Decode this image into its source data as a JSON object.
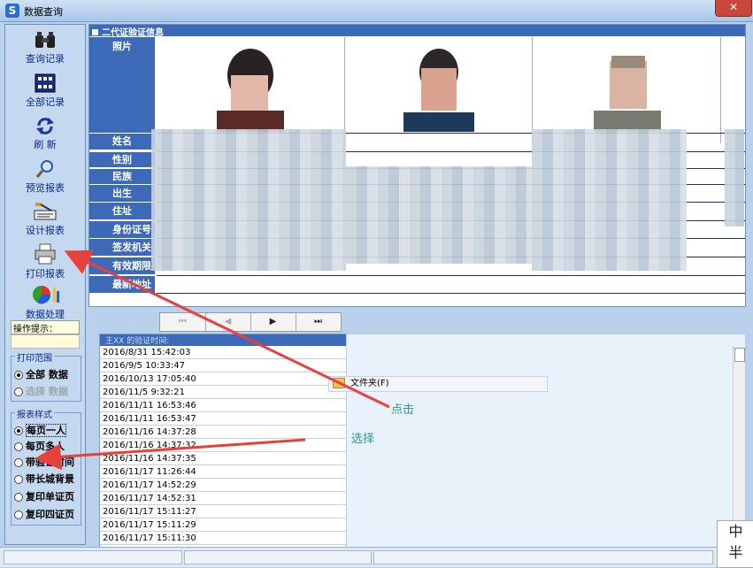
{
  "window": {
    "title": "数据查询",
    "app_icon": "S",
    "close": "✕"
  },
  "sidebar": {
    "tools": [
      {
        "label": "查询记录",
        "icon": "binoculars-icon"
      },
      {
        "label": "全部记录",
        "icon": "grid-icon"
      },
      {
        "label": "刷 新",
        "icon": "refresh-icon"
      },
      {
        "label": "预览报表",
        "icon": "magnifier-icon"
      },
      {
        "label": "设计报表",
        "icon": "design-icon"
      },
      {
        "label": "打印报表",
        "icon": "printer-icon"
      },
      {
        "label": "数据处理",
        "icon": "pie-chart-icon"
      }
    ],
    "hint_label": "操作提示：",
    "print_range": {
      "title": "打印范围",
      "options": [
        {
          "label": "全部 数据",
          "checked": true,
          "enabled": true
        },
        {
          "label": "选择 数据",
          "checked": false,
          "enabled": false
        }
      ]
    },
    "report_style": {
      "title": "报表样式",
      "options": [
        {
          "label": "每页一人",
          "checked": true
        },
        {
          "label": "每页多人",
          "checked": false
        },
        {
          "label": "带验证时间",
          "checked": false
        },
        {
          "label": "带长城背景",
          "checked": false
        },
        {
          "label": "复印单证页",
          "checked": false
        },
        {
          "label": "复印四证页",
          "checked": false
        }
      ]
    }
  },
  "main_panel": {
    "header": "二代证验证信息",
    "photo_label": "照片",
    "fields": [
      "姓名",
      "性别",
      "民族",
      "出生",
      "住址",
      "身份证号",
      "签发机关",
      "有效期限",
      "最新地址"
    ]
  },
  "navigator": {
    "first": "⏮",
    "prev": "◀",
    "next": "▶",
    "last": "⏭"
  },
  "list": {
    "header": "王XX 的验证时间:",
    "items": [
      "2016/8/31 15:42:03",
      "2016/9/5 10:33:47",
      "2016/10/13 17:05:40",
      "2016/11/5 9:32:21",
      "2016/11/11 16:53:46",
      "2016/11/11 16:53:47",
      "2016/11/16 14:37:28",
      "2016/11/16 14:37:32",
      "2016/11/16 14:37:35",
      "2016/11/17 11:26:44",
      "2016/11/17 14:52:29",
      "2016/11/17 14:52:31",
      "2016/11/17 15:11:27",
      "2016/11/17 15:11:29",
      "2016/11/17 15:11:30"
    ]
  },
  "context_item": "文件夹(F)",
  "annotations": {
    "click": "点击",
    "select": "选择",
    "arrow_color": "#e8413c"
  },
  "corner_logo": [
    "中",
    "半"
  ]
}
